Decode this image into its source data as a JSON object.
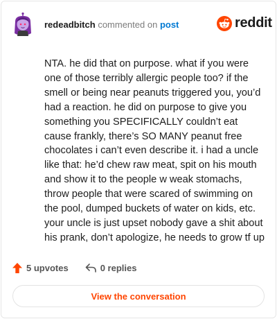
{
  "header": {
    "username": "redeadbitch",
    "commented_on_text": "commented on",
    "post_link": "post",
    "brand": "reddit"
  },
  "comment": {
    "body": "NTA. he did that on purpose. what if you were one of those terribly allergic people too? if the smell or being near peanuts triggered you, you’d had a reaction. he did on purpose to give you something you SPECIFICALLY couldn’t eat cause frankly, there’s SO MANY peanut free chocolates i can’t even describe it. i had a uncle like that: he’d chew raw meat, spit on his mouth and show it to the people w weak stomachs, throw people that were scared of swimming on the pool, dumped buckets of water on kids, etc. your uncle is just upset nobody gave a shit about his prank, don’t apologize, he needs to grow tf up"
  },
  "actions": {
    "upvotes_label": "5 upvotes",
    "replies_label": "0 replies"
  },
  "cta": {
    "view_conversation_label": "View the conversation"
  },
  "icons": {
    "avatar": "snoo-avatar-icon",
    "logo": "reddit-logo-icon",
    "upvote": "upvote-arrow-icon",
    "reply": "reply-arrow-icon"
  },
  "colors": {
    "accent": "#ff4500",
    "link": "#0079d3",
    "text": "#1c1c1c",
    "muted": "#7c7c7c",
    "avatar_hair": "#7b2fa3",
    "avatar_skin": "#c9a6e9"
  }
}
